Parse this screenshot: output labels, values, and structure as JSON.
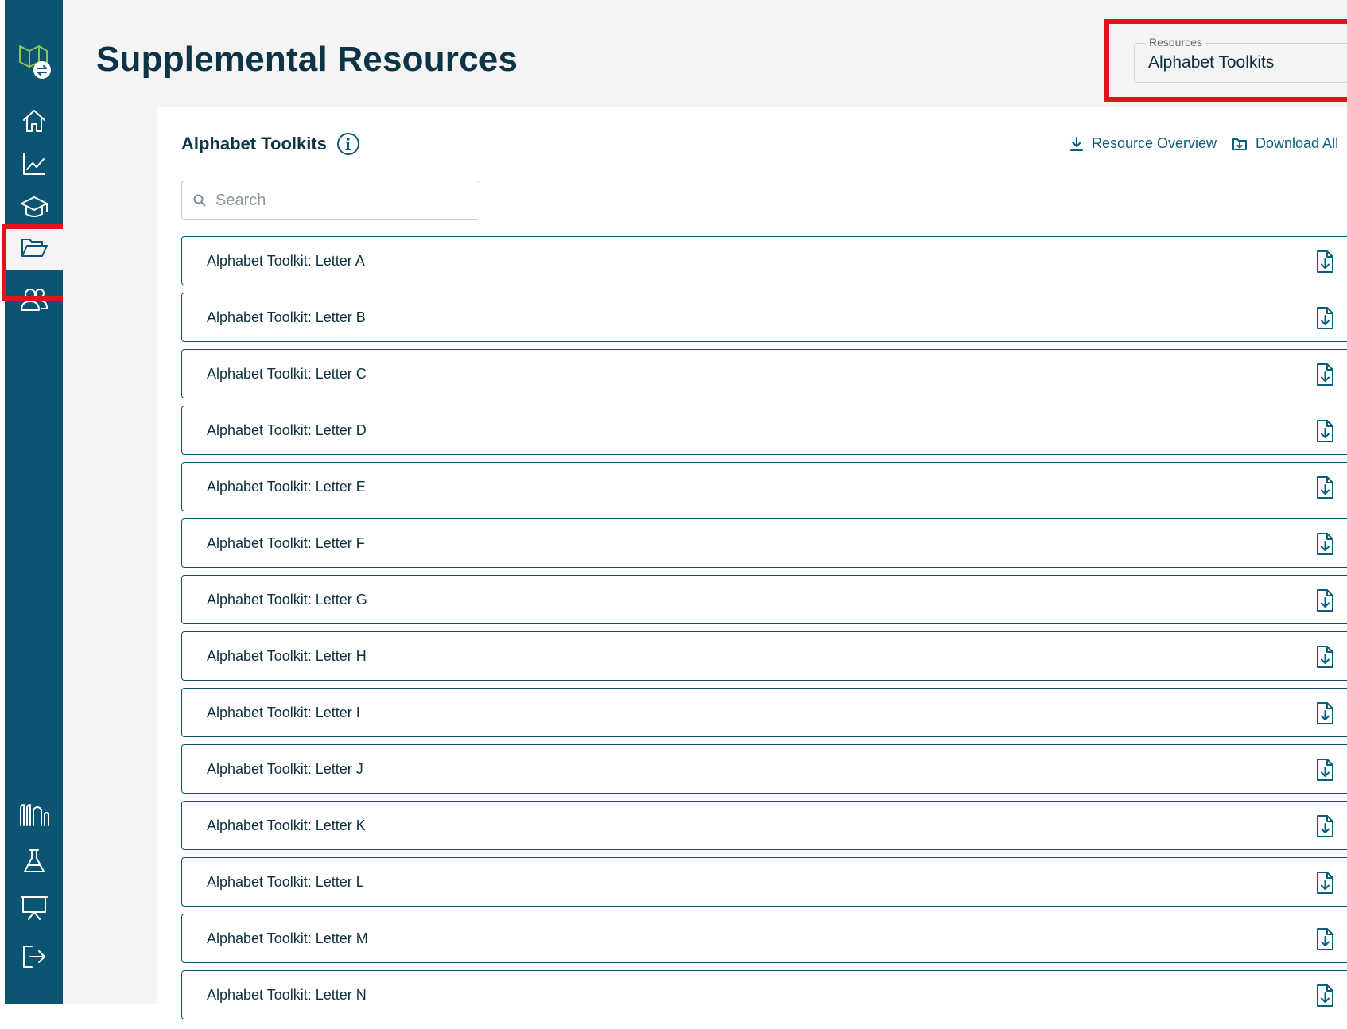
{
  "page": {
    "title": "Supplemental Resources"
  },
  "resources_select": {
    "label": "Resources",
    "value": "Alphabet Toolkits"
  },
  "card": {
    "title": "Alphabet Toolkits",
    "resource_overview_label": "Resource Overview",
    "download_all_label": "Download All",
    "search_placeholder": "Search"
  },
  "sidebar": {
    "items": [
      {
        "icon": "logo-icon"
      },
      {
        "icon": "home-icon"
      },
      {
        "icon": "chart-line-icon"
      },
      {
        "icon": "graduation-cap-icon"
      },
      {
        "icon": "folder-open-icon",
        "active": true
      },
      {
        "icon": "users-icon"
      },
      {
        "icon": "library-icon"
      },
      {
        "icon": "flask-icon"
      },
      {
        "icon": "presentation-icon"
      },
      {
        "icon": "logout-icon"
      }
    ]
  },
  "resources": [
    {
      "label": "Alphabet Toolkit: Letter A"
    },
    {
      "label": "Alphabet Toolkit: Letter B"
    },
    {
      "label": "Alphabet Toolkit: Letter C"
    },
    {
      "label": "Alphabet Toolkit: Letter D"
    },
    {
      "label": "Alphabet Toolkit: Letter E"
    },
    {
      "label": "Alphabet Toolkit: Letter F"
    },
    {
      "label": "Alphabet Toolkit: Letter G"
    },
    {
      "label": "Alphabet Toolkit: Letter H"
    },
    {
      "label": "Alphabet Toolkit: Letter I"
    },
    {
      "label": "Alphabet Toolkit: Letter J"
    },
    {
      "label": "Alphabet Toolkit: Letter K"
    },
    {
      "label": "Alphabet Toolkit: Letter L"
    },
    {
      "label": "Alphabet Toolkit: Letter M"
    },
    {
      "label": "Alphabet Toolkit: Letter N"
    }
  ],
  "colors": {
    "sidebar": "#0b5572",
    "accent": "#0b5e7c",
    "highlight": "#e3131b"
  }
}
